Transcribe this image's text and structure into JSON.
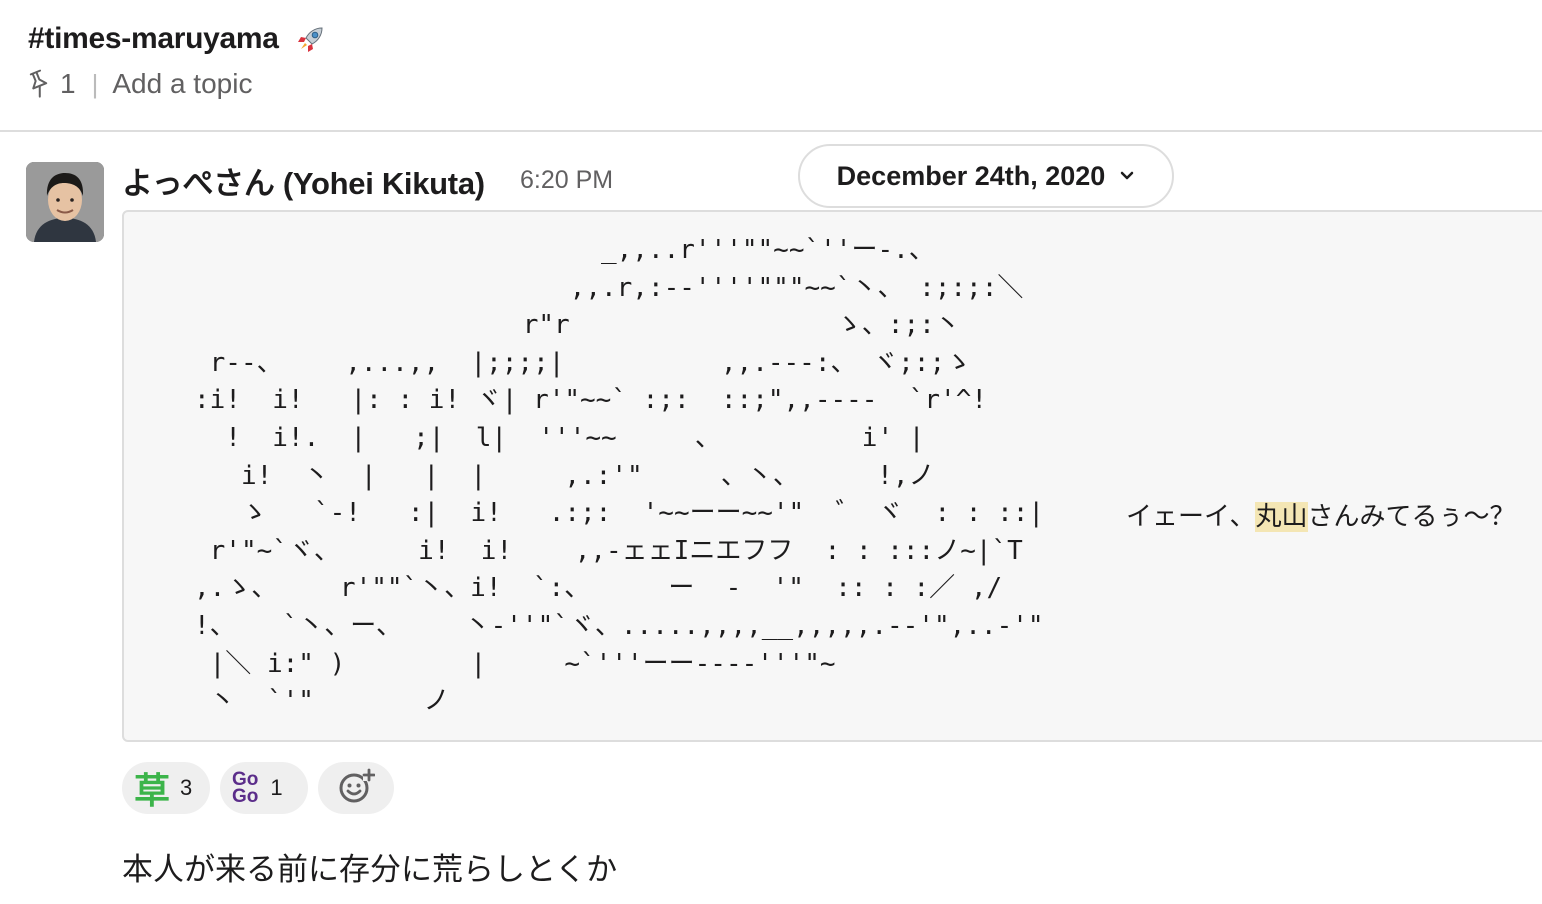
{
  "channel": {
    "name": "#times-maruyama",
    "pinned_count": "1",
    "topic_placeholder": "Add a topic"
  },
  "message": {
    "sender": "よっぺさん (Yohei Kikuta)",
    "time": "6:20 PM",
    "date_divider": "December 24th, 2020",
    "ascii_art": "                          _,,..r'''\"\"~~`''ー-.、\n                        ,,.r,:--''''\"\"\"~~`丶、 :;:;:＼\n                     r\"r                 ゝ、:;:丶\n r--、    ,...,,  |;;;;|          ,,.---:、 ヾ;:;ゝ\n:i!  i!   |: : i! ヾ| r'\"~~` :;:  ::;\",,----  `r'^!\n  !  i!.  |   ;|  l|  '''~~     、         i' |\n   i!  丶  |   |  |     ,.:'\"     、丶、     !,ノ\n   ゝ   `-!   :|  i!   .:;:  '~~ーー~~'\"  ゛ ヾ  : : ::|\n r'\"~`ヾ、     i!  i!    ,,-ェェIニエフフ  : : :::ノ~|`T\n,.ゝ、    r'\"\"`丶、i!  `:、     ー  -  '\"  :: : :／ ,/\n!、   `丶、ー、    丶-''\"`ヾ、.....,,,,__,,,,,.--'\",..-'\"\n |＼ i:\" )        |     ~`'''ーー----'''\"~\n 丶  `'\"       ノ",
    "ascii_text_before": "イェーイ、",
    "ascii_text_highlight": "丸山",
    "ascii_text_after": "さんみてるぅ～？"
  },
  "reactions": [
    {
      "emoji": "草",
      "count": "3"
    },
    {
      "emoji": "Go Go",
      "count": "1"
    },
    {
      "emoji": "add-reaction"
    }
  ],
  "followup_message": "本人が来る前に存分に荒らしとくか"
}
